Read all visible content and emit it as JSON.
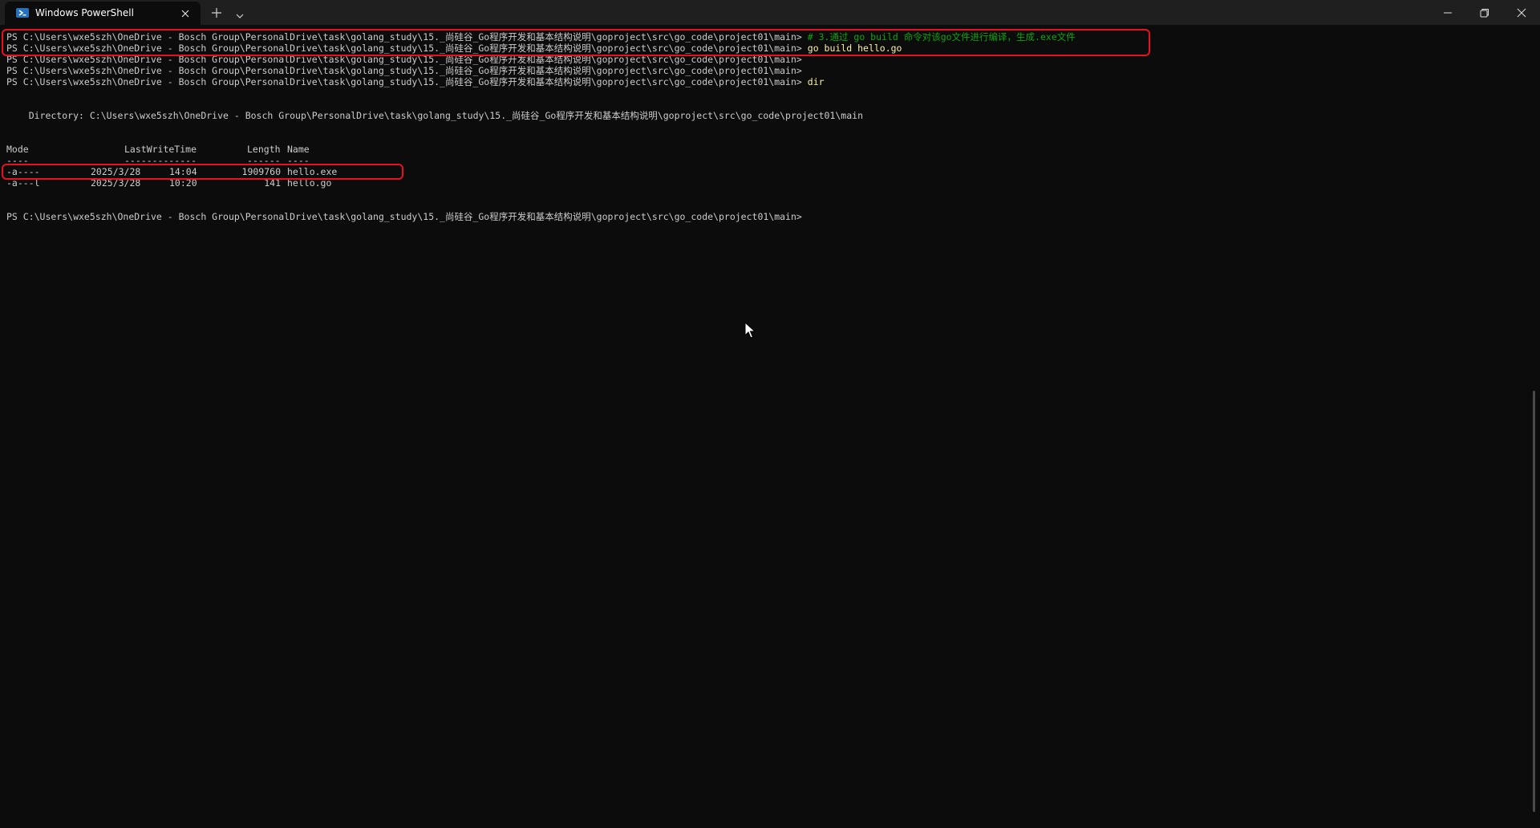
{
  "window": {
    "tab_title": "Windows PowerShell",
    "tab_icon": "powershell-icon"
  },
  "terminal": {
    "prompt": "PS C:\\Users\\wxe5szh\\OneDrive - Bosch Group\\PersonalDrive\\task\\golang_study\\15._尚硅谷_Go程序开发和基本结构说明\\goproject\\src\\go_code\\project01\\main>",
    "lines": [
      {
        "command": "# 3.通过 go build 命令对该go文件进行编译，生成.exe文件"
      },
      {
        "command": "go build hello.go"
      },
      {
        "command": ""
      },
      {
        "command": ""
      },
      {
        "command": "dir"
      }
    ],
    "directory_line": "    Directory: C:\\Users\\wxe5szh\\OneDrive - Bosch Group\\PersonalDrive\\task\\golang_study\\15._尚硅谷_Go程序开发和基本结构说明\\goproject\\src\\go_code\\project01\\main",
    "listing": {
      "headers": {
        "mode": "Mode",
        "last_write_time": "LastWriteTime",
        "length": "Length",
        "name": "Name"
      },
      "underlines": {
        "mode": "----",
        "last_write_time": "-------------",
        "length": "------",
        "name": "----"
      },
      "rows": [
        {
          "mode": "-a----",
          "date": "2025/3/28",
          "time": "14:04",
          "length": "1909760",
          "name": "hello.exe"
        },
        {
          "mode": "-a---l",
          "date": "2025/3/28",
          "time": "10:20",
          "length": "141",
          "name": "hello.go"
        }
      ]
    },
    "final_prompt_command": ""
  },
  "colors": {
    "background": "#0c0c0c",
    "text": "#cccccc",
    "command": "#f9f1a5",
    "comment": "#13a10e",
    "highlight": "#e81123"
  }
}
